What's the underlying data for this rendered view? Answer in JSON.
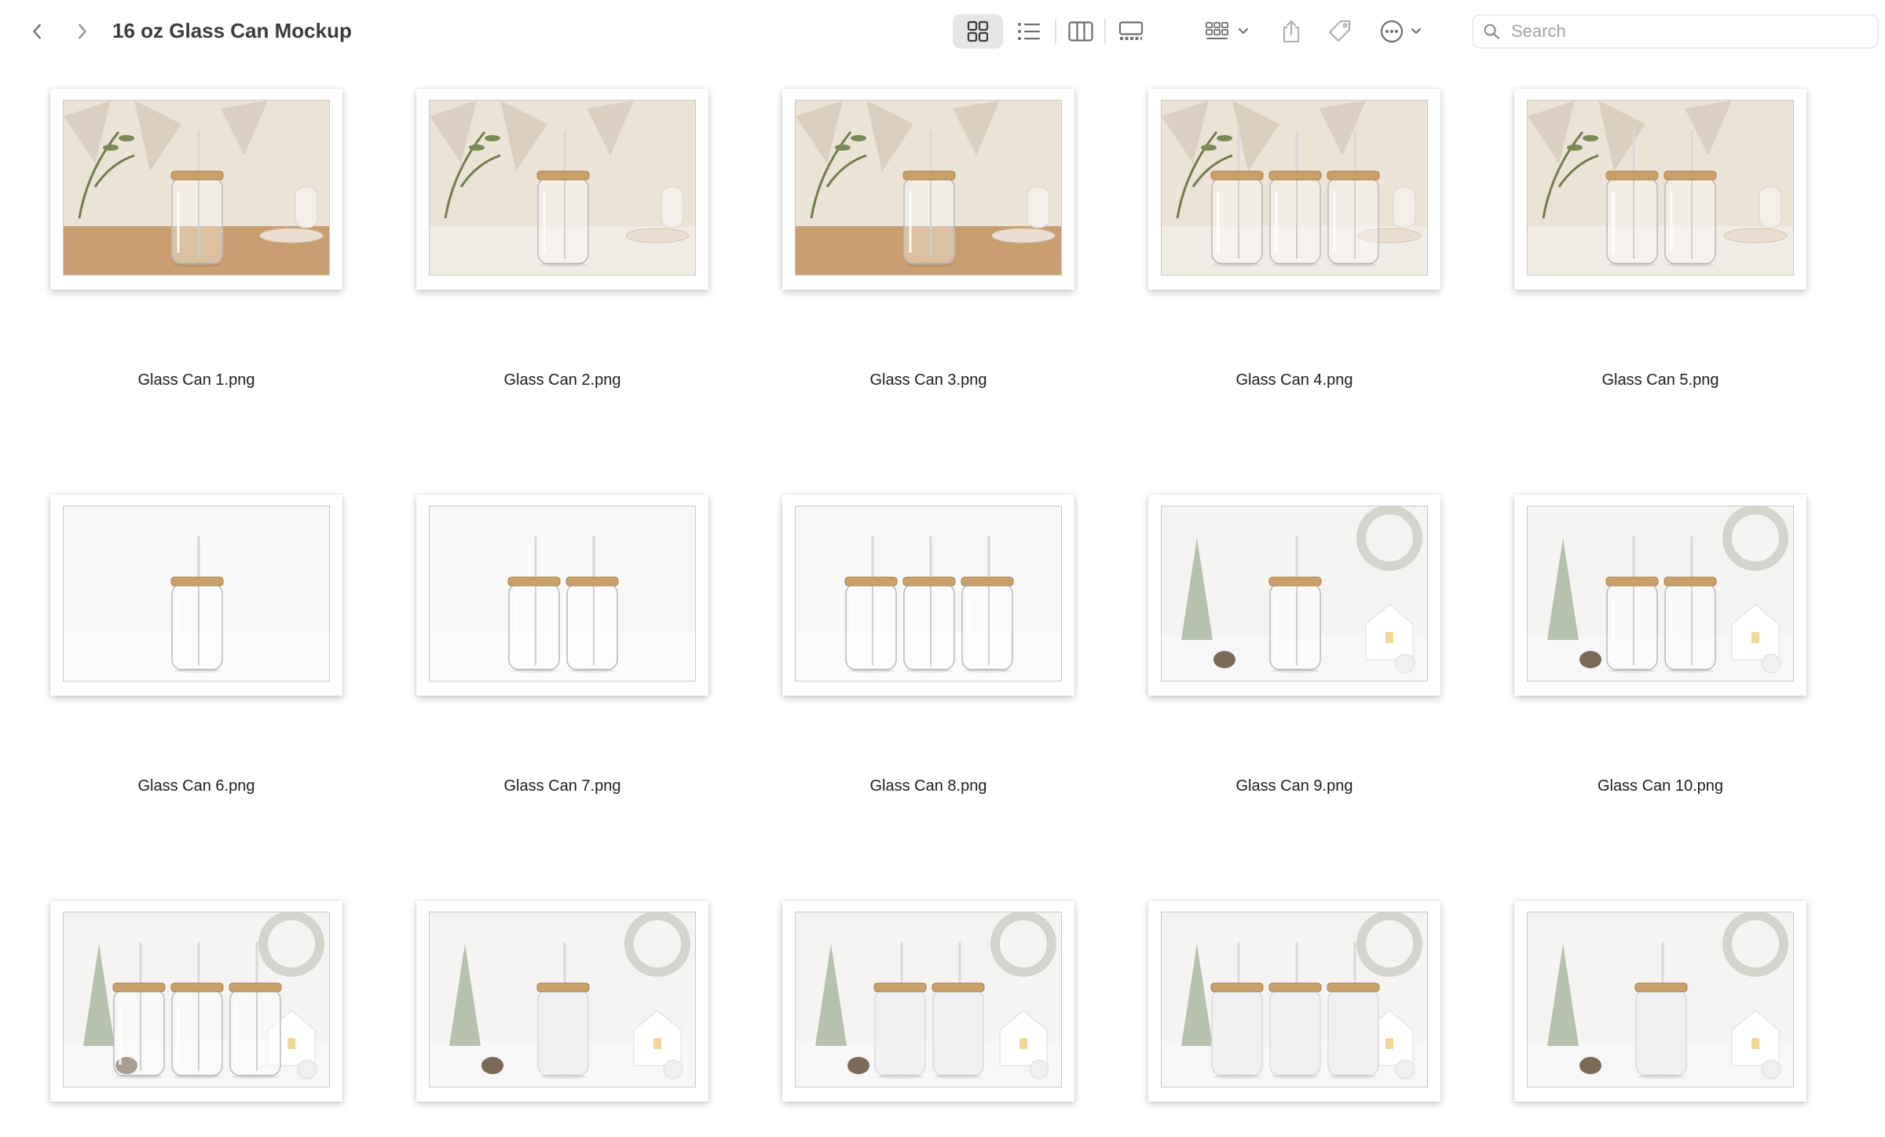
{
  "window": {
    "title": "16 oz Glass Can Mockup"
  },
  "toolbar": {
    "back_icon": "chevron-left-icon",
    "forward_icon": "chevron-right-icon",
    "views": [
      "icon-view-icon",
      "list-view-icon",
      "column-view-icon",
      "gallery-view-icon"
    ],
    "active_view": "icon-view-icon",
    "group_icon": "group-by-icon",
    "share_icon": "share-icon",
    "tag_icon": "tag-icon",
    "more_icon": "more-options-icon"
  },
  "search": {
    "placeholder": "Search",
    "value": ""
  },
  "colors": {
    "accent_active_bg": "#e6e6e8",
    "icon_gray": "#6e6e73",
    "bamboo": "#c9a06a",
    "warm_wall": "#ebe2d6",
    "white_scene": "#f7f7f7"
  },
  "files": [
    {
      "name": "Glass Can 1.png",
      "scene": "warm",
      "jars": 1,
      "table": "wood"
    },
    {
      "name": "Glass Can 2.png",
      "scene": "warm",
      "jars": 1,
      "table": "marble"
    },
    {
      "name": "Glass Can 3.png",
      "scene": "warm",
      "jars": 1,
      "table": "wood"
    },
    {
      "name": "Glass Can 4.png",
      "scene": "warm",
      "jars": 3,
      "table": "marble"
    },
    {
      "name": "Glass Can 5.png",
      "scene": "warm",
      "jars": 2,
      "table": "marble"
    },
    {
      "name": "Glass Can 6.png",
      "scene": "white",
      "jars": 1,
      "table": "white"
    },
    {
      "name": "Glass Can 7.png",
      "scene": "white",
      "jars": 2,
      "table": "white"
    },
    {
      "name": "Glass Can 8.png",
      "scene": "white",
      "jars": 3,
      "table": "white"
    },
    {
      "name": "Glass Can 9.png",
      "scene": "winter",
      "jars": 1,
      "table": "white"
    },
    {
      "name": "Glass Can 10.png",
      "scene": "winter",
      "jars": 2,
      "table": "white"
    },
    {
      "name": "",
      "scene": "winter",
      "jars": 3,
      "table": "white"
    },
    {
      "name": "",
      "scene": "winter-frost",
      "jars": 1,
      "table": "white"
    },
    {
      "name": "",
      "scene": "winter-frost",
      "jars": 2,
      "table": "white"
    },
    {
      "name": "",
      "scene": "winter-frost",
      "jars": 3,
      "table": "white"
    },
    {
      "name": "",
      "scene": "winter-frost",
      "jars": 1,
      "table": "white"
    }
  ]
}
